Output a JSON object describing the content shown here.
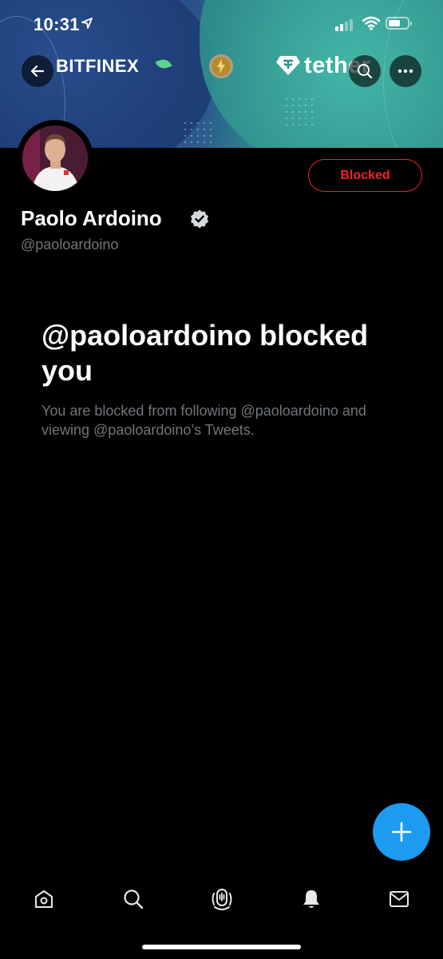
{
  "status_bar": {
    "time": "10:31"
  },
  "banner": {
    "brand_left": "BITFINEX",
    "brand_right": "tether"
  },
  "profile": {
    "name": "Paolo Ardoino",
    "handle": "@paoloardoino",
    "relationship_button": "Blocked"
  },
  "blocked_notice": {
    "title": "@paoloardoino blocked you",
    "description": "You are blocked from following @paoloardoino and viewing @paoloardoino’s Tweets."
  },
  "colors": {
    "accent": "#1d9bf0",
    "danger": "#f4212e",
    "background": "#000000",
    "secondary_text": "#71767b"
  },
  "icons": {
    "back": "arrow-left-icon",
    "search": "search-icon",
    "more": "more-horizontal-icon",
    "verified": "verified-badge-icon",
    "compose": "plus-icon",
    "tabs": [
      "home-icon",
      "search-icon",
      "spaces-icon",
      "notifications-bell-icon",
      "messages-envelope-icon"
    ]
  }
}
